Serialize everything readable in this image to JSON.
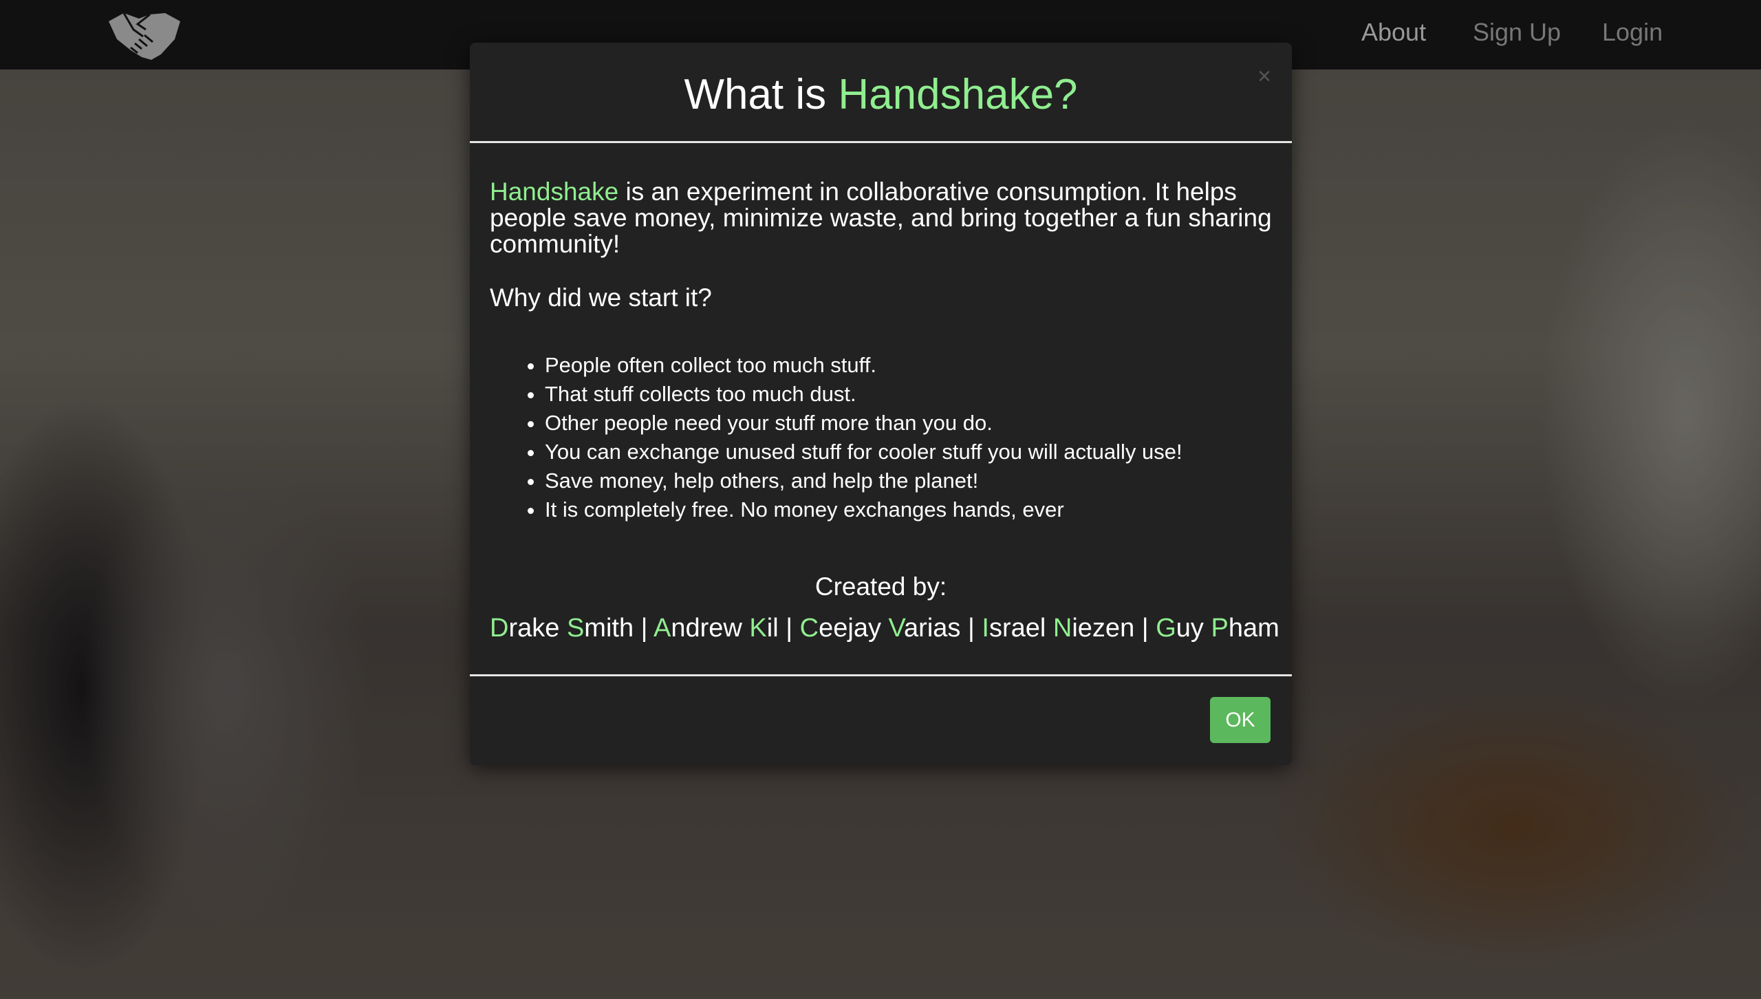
{
  "nav": {
    "logo": "handshake-logo",
    "links": [
      "About",
      "Sign Up",
      "Login"
    ]
  },
  "modal": {
    "title_prefix": "What is ",
    "title_highlight": "Handshake?",
    "close": "×",
    "intro_highlight": "Handshake",
    "intro_rest": " is an experiment in collaborative consumption. It helps people save money, minimize waste, and bring together a fun sharing community!",
    "why_heading": "Why did we start it?",
    "reasons": [
      "People often collect too much stuff.",
      "That stuff collects too much dust.",
      "Other people need your stuff more than you do.",
      "You can exchange unused stuff for cooler stuff you will actually use!",
      "Save money, help others, and help the planet!",
      "It is completely free. No money exchanges hands, ever"
    ],
    "created_by": "Created by:",
    "creators": [
      {
        "f1": "D",
        "r1": "rake ",
        "f2": "S",
        "r2": "mith"
      },
      {
        "f1": "A",
        "r1": "ndrew ",
        "f2": "K",
        "r2": "il"
      },
      {
        "f1": "C",
        "r1": "eejay ",
        "f2": "V",
        "r2": "arias"
      },
      {
        "f1": "I",
        "r1": "srael ",
        "f2": "N",
        "r2": "iezen"
      },
      {
        "f1": "G",
        "r1": "uy ",
        "f2": "P",
        "r2": "ham"
      }
    ],
    "separator": " | ",
    "ok_label": "OK"
  },
  "colors": {
    "accent": "#90ee90",
    "ok": "#5cb85c",
    "nav_bg": "#111111",
    "modal_bg": "#222222"
  }
}
